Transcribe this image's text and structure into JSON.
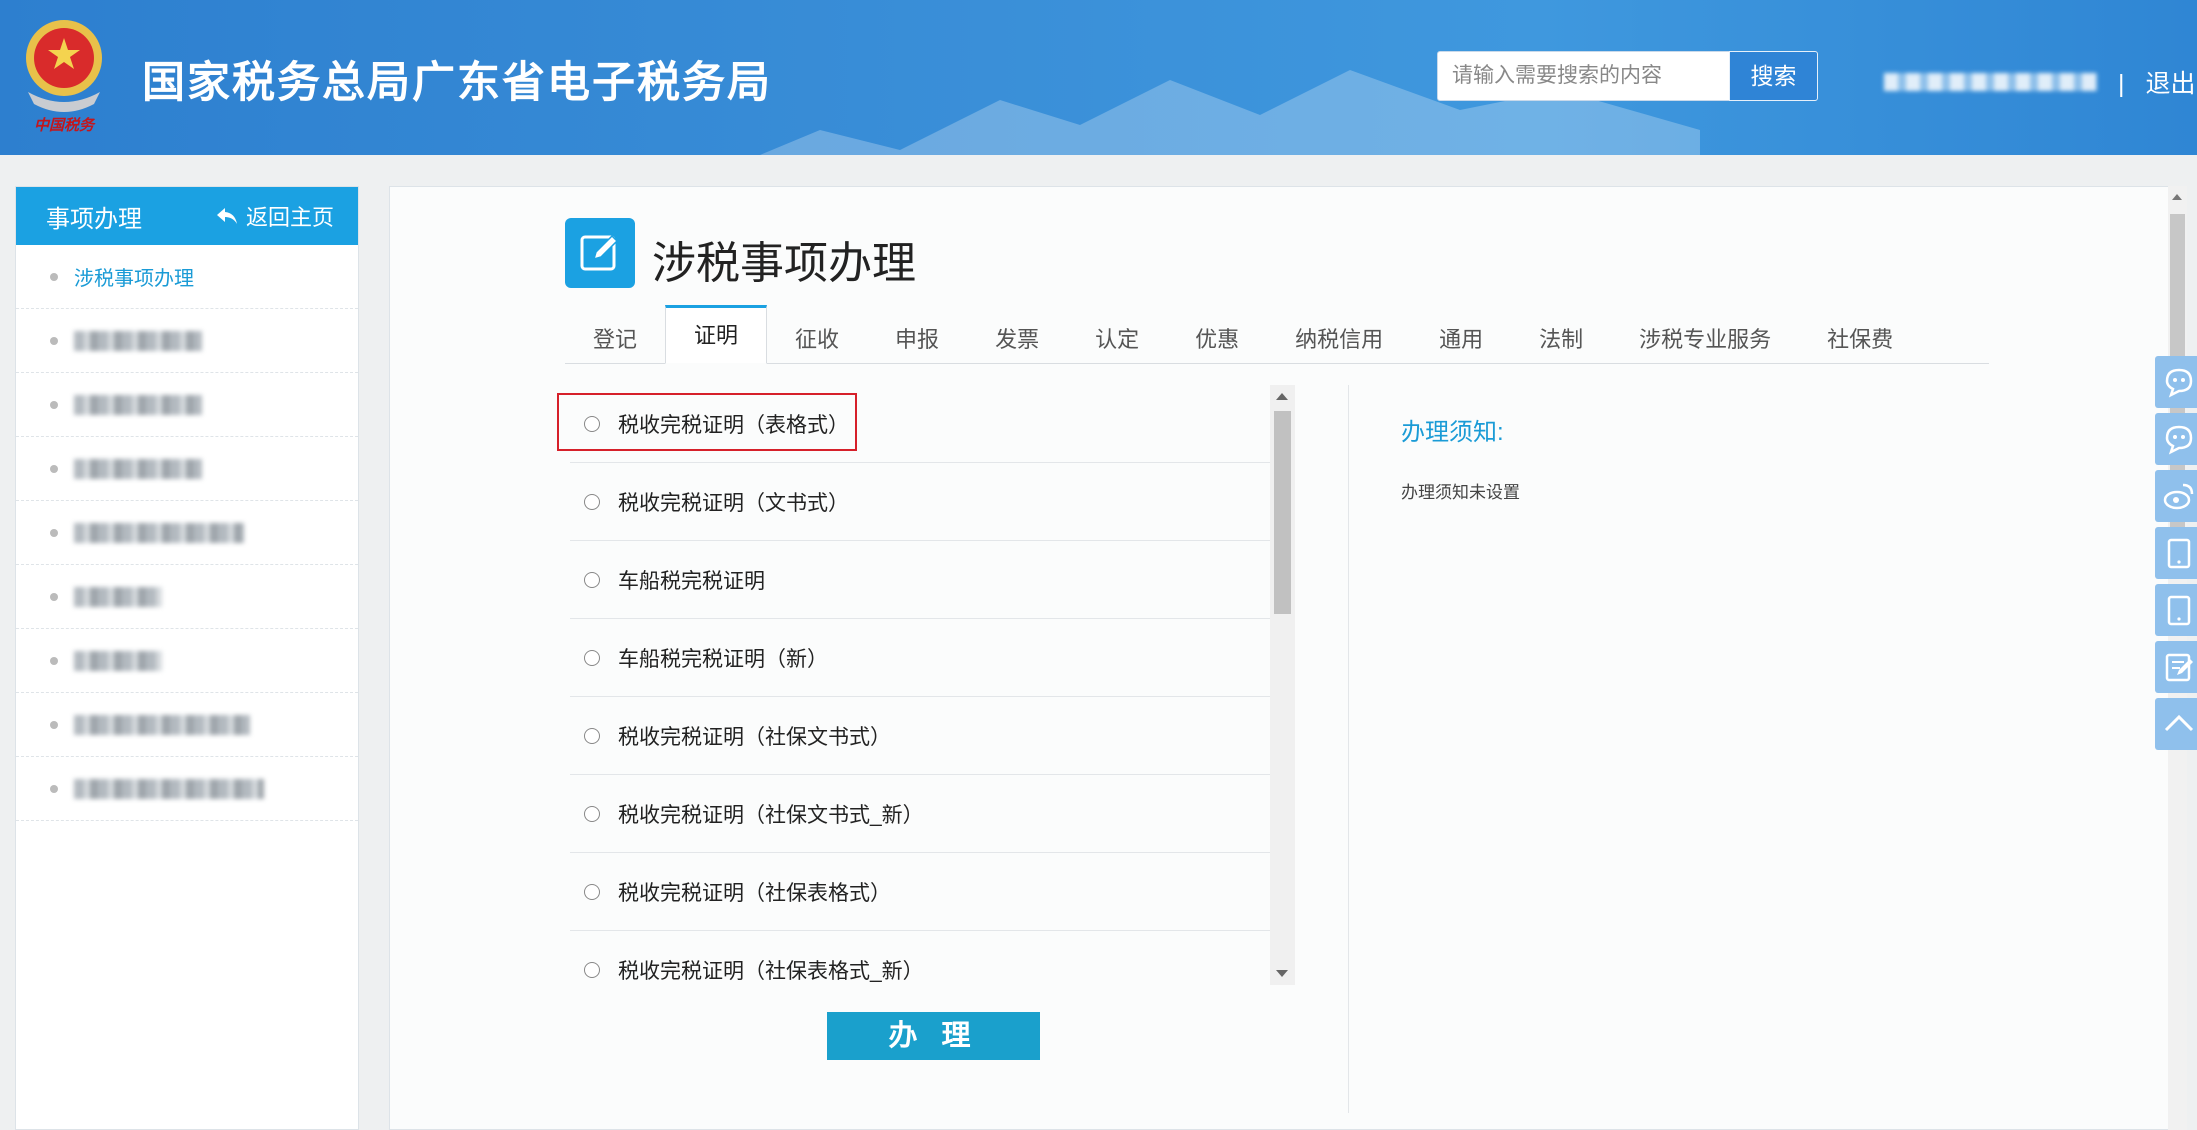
{
  "header": {
    "site_title": "国家税务总局广东省电子税务局",
    "emblem_caption": "中国税务",
    "search_placeholder": "请输入需要搜索的内容",
    "search_button": "搜索",
    "separator": "|",
    "logout": "退出"
  },
  "sidebar": {
    "title": "事项办理",
    "back_home": "返回主页",
    "items": [
      {
        "label": "涉税事项办理",
        "active": true
      },
      {
        "label": "",
        "blurred": true
      },
      {
        "label": "",
        "blurred": true
      },
      {
        "label": "",
        "blurred": true
      },
      {
        "label": "",
        "blurred": true
      },
      {
        "label": "",
        "blurred": true
      },
      {
        "label": "",
        "blurred": true
      },
      {
        "label": "",
        "blurred": true
      },
      {
        "label": "",
        "blurred": true
      }
    ]
  },
  "main": {
    "page_title": "涉税事项办理",
    "tabs": [
      "登记",
      "证明",
      "征收",
      "申报",
      "发票",
      "认定",
      "优惠",
      "纳税信用",
      "通用",
      "法制",
      "涉税专业服务",
      "社保费"
    ],
    "active_tab": "证明",
    "options": [
      "税收完税证明（表格式）",
      "税收完税证明（文书式）",
      "车船税完税证明",
      "车船税完税证明（新）",
      "税收完税证明（社保文书式）",
      "税收完税证明（社保文书式_新）",
      "税收完税证明（社保表格式）",
      "税收完税证明（社保表格式_新）"
    ],
    "highlighted_option": "税收完税证明（表格式）",
    "action_button": "办 理",
    "notice": {
      "title": "办理须知:",
      "text": "办理须知未设置"
    }
  },
  "float_toolbar": [
    "chat-icon",
    "chat-icon",
    "weibo-icon",
    "tablet-icon",
    "tablet-icon",
    "edit-icon",
    "back-to-top-icon"
  ],
  "colors": {
    "header_blue": "#2f84d6",
    "accent": "#1ba1e2",
    "action_button": "#1aa0cc",
    "highlight_border": "#d6202a"
  }
}
